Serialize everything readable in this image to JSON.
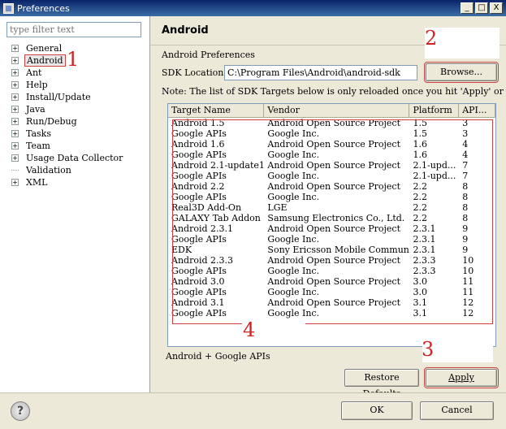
{
  "window": {
    "title": "Preferences",
    "controls": [
      "_",
      "□",
      "X"
    ]
  },
  "sidebar": {
    "filter_placeholder": "type filter text",
    "items": [
      {
        "label": "General",
        "expandable": true
      },
      {
        "label": "Android",
        "expandable": true,
        "selected": true
      },
      {
        "label": "Ant",
        "expandable": true
      },
      {
        "label": "Help",
        "expandable": true
      },
      {
        "label": "Install/Update",
        "expandable": true
      },
      {
        "label": "Java",
        "expandable": true
      },
      {
        "label": "Run/Debug",
        "expandable": true
      },
      {
        "label": "Tasks",
        "expandable": true
      },
      {
        "label": "Team",
        "expandable": true
      },
      {
        "label": "Usage Data Collector",
        "expandable": true
      },
      {
        "label": "Validation",
        "expandable": false
      },
      {
        "label": "XML",
        "expandable": true
      }
    ]
  },
  "annotations": {
    "a1": "1",
    "a2": "2",
    "a3": "3",
    "a4": "4"
  },
  "page": {
    "title": "Android",
    "section": "Android Preferences",
    "sdk_label": "SDK Location:",
    "sdk_value": "C:\\Program Files\\Android\\android-sdk",
    "browse": "Browse...",
    "note": "Note: The list of SDK Targets below is only reloaded once you hit 'Apply' or 'OK'.",
    "selected_description": "Android + Google APIs",
    "restore_defaults": "Restore Defaults",
    "apply": "Apply"
  },
  "table": {
    "columns": [
      "Target Name",
      "Vendor",
      "Platform",
      "API..."
    ],
    "rows": [
      [
        "Android 1.5",
        "Android Open Source Project",
        "1.5",
        "3"
      ],
      [
        "Google APIs",
        "Google Inc.",
        "1.5",
        "3"
      ],
      [
        "Android 1.6",
        "Android Open Source Project",
        "1.6",
        "4"
      ],
      [
        "Google APIs",
        "Google Inc.",
        "1.6",
        "4"
      ],
      [
        "Android 2.1-update1",
        "Android Open Source Project",
        "2.1-upd...",
        "7"
      ],
      [
        "Google APIs",
        "Google Inc.",
        "2.1-upd...",
        "7"
      ],
      [
        "Android 2.2",
        "Android Open Source Project",
        "2.2",
        "8"
      ],
      [
        "Google APIs",
        "Google Inc.",
        "2.2",
        "8"
      ],
      [
        "Real3D Add-On",
        "LGE",
        "2.2",
        "8"
      ],
      [
        "GALAXY Tab Addon",
        "Samsung Electronics Co., Ltd.",
        "2.2",
        "8"
      ],
      [
        "Android 2.3.1",
        "Android Open Source Project",
        "2.3.1",
        "9"
      ],
      [
        "Google APIs",
        "Google Inc.",
        "2.3.1",
        "9"
      ],
      [
        "EDK",
        "Sony Ericsson Mobile Communic...",
        "2.3.1",
        "9"
      ],
      [
        "Android 2.3.3",
        "Android Open Source Project",
        "2.3.3",
        "10"
      ],
      [
        "Google APIs",
        "Google Inc.",
        "2.3.3",
        "10"
      ],
      [
        "Android 3.0",
        "Android Open Source Project",
        "3.0",
        "11"
      ],
      [
        "Google APIs",
        "Google Inc.",
        "3.0",
        "11"
      ],
      [
        "Android 3.1",
        "Android Open Source Project",
        "3.1",
        "12"
      ],
      [
        "Google APIs",
        "Google Inc.",
        "3.1",
        "12"
      ]
    ]
  },
  "footer": {
    "help": "?",
    "ok": "OK",
    "cancel": "Cancel"
  },
  "colors": {
    "annotation_red": "#d42020",
    "titlebar": "#0a246a",
    "dialog_bg": "#ece9d8"
  }
}
